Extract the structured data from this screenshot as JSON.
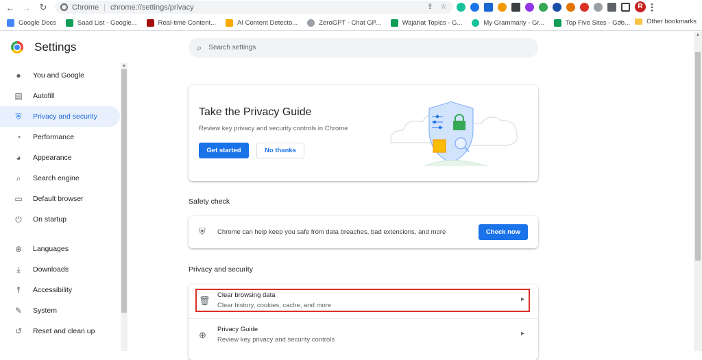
{
  "browser": {
    "site_label": "Chrome",
    "url": "chrome://settings/privacy",
    "profile_initial": "R"
  },
  "bookmarks": [
    {
      "label": "Google Docs",
      "color": "#4285f4"
    },
    {
      "label": "Saad List - Google...",
      "color": "#0f9d58"
    },
    {
      "label": "Real-time Content...",
      "color": "#a50e0e"
    },
    {
      "label": "AI Content Detecto...",
      "color": "#f9ab00"
    },
    {
      "label": "ZeroGPT - Chat GP...",
      "color": "#9aa0a6"
    },
    {
      "label": "Wajahat Topics - G...",
      "color": "#0f9d58"
    },
    {
      "label": "My Grammarly - Gr...",
      "color": "#15c39a"
    },
    {
      "label": "Top Five Sites - Goo...",
      "color": "#0f9d58"
    }
  ],
  "bookmarks_more": "»",
  "other_bookmarks": "Other bookmarks",
  "header": {
    "title": "Settings",
    "search_placeholder": "Search settings"
  },
  "sidebar": {
    "items": [
      {
        "label": "You and Google",
        "icon": "person-icon"
      },
      {
        "label": "Autofill",
        "icon": "autofill-icon"
      },
      {
        "label": "Privacy and security",
        "icon": "shield-icon",
        "active": true
      },
      {
        "label": "Performance",
        "icon": "speedometer-icon"
      },
      {
        "label": "Appearance",
        "icon": "palette-icon"
      },
      {
        "label": "Search engine",
        "icon": "search-icon"
      },
      {
        "label": "Default browser",
        "icon": "browser-icon"
      },
      {
        "label": "On startup",
        "icon": "power-icon"
      }
    ],
    "items2": [
      {
        "label": "Languages",
        "icon": "globe-icon"
      },
      {
        "label": "Downloads",
        "icon": "download-icon"
      },
      {
        "label": "Accessibility",
        "icon": "accessibility-icon"
      },
      {
        "label": "System",
        "icon": "wrench-icon"
      },
      {
        "label": "Reset and clean up",
        "icon": "reset-icon"
      }
    ]
  },
  "privacy_guide": {
    "title": "Take the Privacy Guide",
    "description": "Review key privacy and security controls in Chrome",
    "primary_button": "Get started",
    "secondary_button": "No thanks"
  },
  "safety_check": {
    "section_title": "Safety check",
    "text": "Chrome can help keep you safe from data breaches, bad extensions, and more",
    "button": "Check now"
  },
  "privacy_security": {
    "section_title": "Privacy and security",
    "rows": [
      {
        "title": "Clear browsing data",
        "subtitle": "Clear history, cookies, cache, and more",
        "icon": "trash-icon"
      },
      {
        "title": "Privacy Guide",
        "subtitle": "Review key privacy and security controls",
        "icon": "compass-icon"
      }
    ]
  },
  "colors": {
    "accent": "#1a73e8",
    "active_nav_bg": "#e8f0fe",
    "highlight_border": "#d93025"
  }
}
